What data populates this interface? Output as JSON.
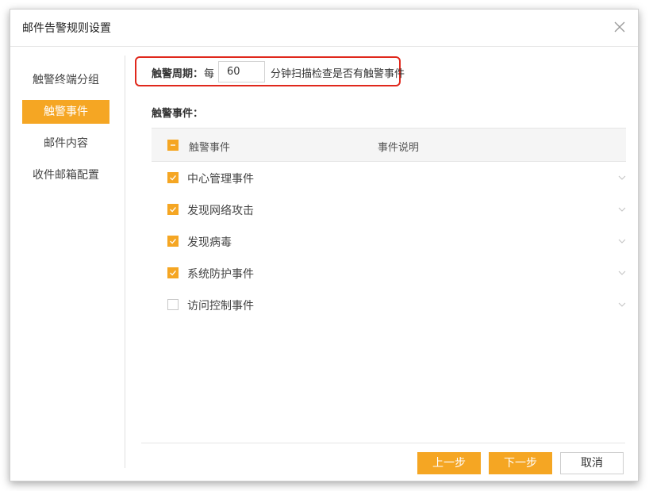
{
  "dialog": {
    "title": "邮件告警规则设置"
  },
  "sidebar": {
    "items": [
      {
        "label": "触警终端分组",
        "active": false
      },
      {
        "label": "触警事件",
        "active": true
      },
      {
        "label": "邮件内容",
        "active": false
      },
      {
        "label": "收件邮箱配置",
        "active": false
      }
    ]
  },
  "trigger": {
    "label": "触警周期：",
    "each": "每",
    "value": "60",
    "suffix": "分钟扫描检查是否有触警事件",
    "highlight_color": "#e0281c"
  },
  "events": {
    "section_label": "触警事件：",
    "header": {
      "name": "触警事件",
      "description": "事件说明",
      "select_all_state": "indeterminate"
    },
    "rows": [
      {
        "name": "中心管理事件",
        "checked": true
      },
      {
        "name": "发现网络攻击",
        "checked": true
      },
      {
        "name": "发现病毒",
        "checked": true
      },
      {
        "name": "系统防护事件",
        "checked": true
      },
      {
        "name": "访问控制事件",
        "checked": false
      }
    ]
  },
  "footer": {
    "prev_label": "上一步",
    "next_label": "下一步",
    "cancel_label": "取消"
  },
  "colors": {
    "accent": "#f5a623"
  }
}
